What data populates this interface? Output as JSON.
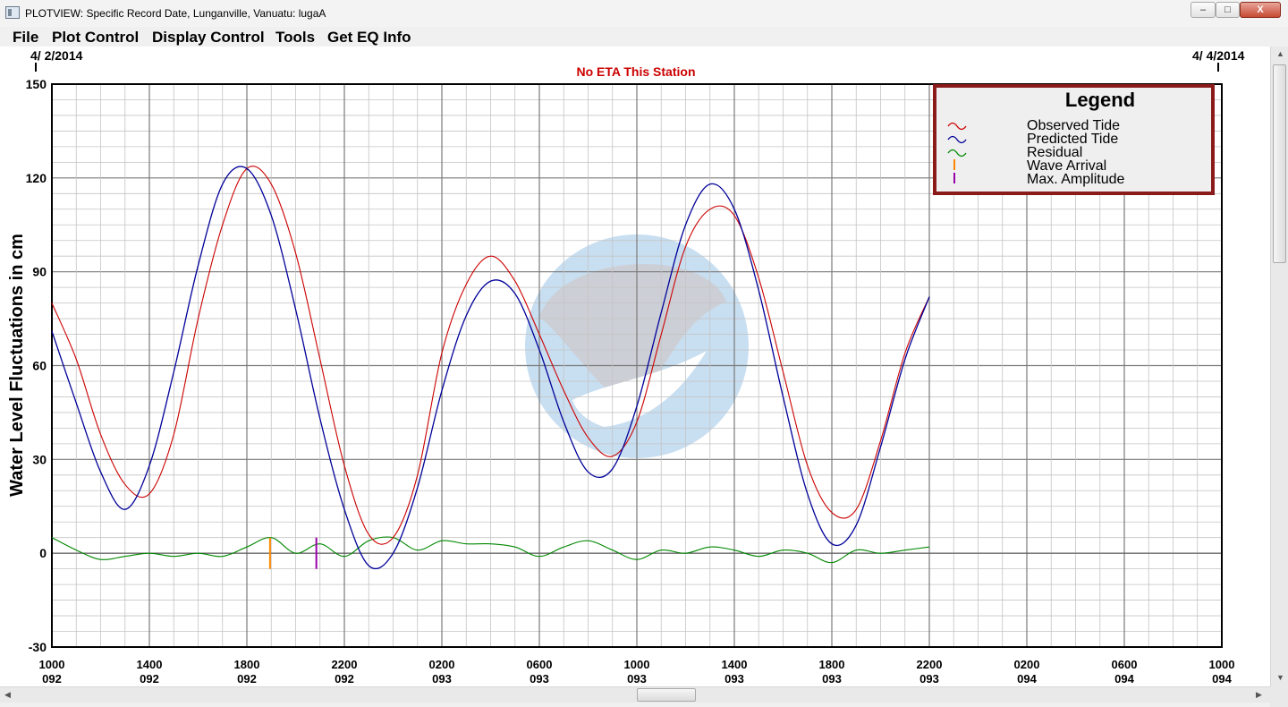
{
  "window": {
    "title": "PLOTVIEW: Specific Record Date, Lunganville, Vanuatu: lugaA",
    "minimize_glyph": "–",
    "maximize_glyph": "□",
    "close_glyph": "X"
  },
  "menu": [
    "File",
    "Plot Control",
    "Display Control",
    "Tools",
    "Get EQ Info"
  ],
  "chart_data": {
    "type": "line",
    "status_text": "No ETA This Station",
    "start_date": "4/ 2/2014",
    "end_date": "4/ 4/2014",
    "ylabel": "Water Level Fluctuations in cm",
    "ylim": [
      -30,
      150
    ],
    "yticks": [
      "150",
      "120",
      "90",
      "60",
      "30",
      "0",
      "-30"
    ],
    "xlim": [
      0,
      48
    ],
    "xticks": [
      {
        "time": "1000",
        "day": "092"
      },
      {
        "time": "1400",
        "day": "092"
      },
      {
        "time": "1800",
        "day": "092"
      },
      {
        "time": "2200",
        "day": "092"
      },
      {
        "time": "0200",
        "day": "093"
      },
      {
        "time": "0600",
        "day": "093"
      },
      {
        "time": "1000",
        "day": "093"
      },
      {
        "time": "1400",
        "day": "093"
      },
      {
        "time": "1800",
        "day": "093"
      },
      {
        "time": "2200",
        "day": "093"
      },
      {
        "time": "0200",
        "day": "094"
      },
      {
        "time": "0600",
        "day": "094"
      },
      {
        "time": "1000",
        "day": "094"
      }
    ],
    "grid": true,
    "legend": {
      "title": "Legend",
      "placement": "top-right",
      "entries": [
        {
          "label": "Observed Tide",
          "color": "#cc0000"
        },
        {
          "label": "Predicted Tide",
          "color": "#000099"
        },
        {
          "label": "Residual",
          "color": "#008800"
        },
        {
          "label": "Wave Arrival",
          "color": "#ff8800"
        },
        {
          "label": "Max. Amplitude",
          "color": "#9900aa"
        }
      ]
    },
    "series": [
      {
        "name": "Predicted Tide",
        "color": "#000099",
        "points": [
          [
            0,
            71
          ],
          [
            1,
            48
          ],
          [
            2,
            26
          ],
          [
            3,
            14
          ],
          [
            4,
            28
          ],
          [
            5,
            58
          ],
          [
            6,
            92
          ],
          [
            7,
            118
          ],
          [
            8,
            123
          ],
          [
            9,
            108
          ],
          [
            10,
            78
          ],
          [
            11,
            43
          ],
          [
            12,
            14
          ],
          [
            13,
            -4
          ],
          [
            14,
            0
          ],
          [
            15,
            21
          ],
          [
            16,
            52
          ],
          [
            17,
            76
          ],
          [
            18,
            87
          ],
          [
            19,
            83
          ],
          [
            20,
            65
          ],
          [
            21,
            42
          ],
          [
            22,
            26
          ],
          [
            23,
            27
          ],
          [
            24,
            47
          ],
          [
            25,
            77
          ],
          [
            26,
            105
          ],
          [
            27,
            118
          ],
          [
            28,
            110
          ],
          [
            29,
            84
          ],
          [
            30,
            50
          ],
          [
            31,
            19
          ],
          [
            32,
            3
          ],
          [
            33,
            9
          ],
          [
            34,
            34
          ],
          [
            35,
            62
          ],
          [
            36,
            82
          ]
        ]
      },
      {
        "name": "Observed Tide",
        "color": "#cc0000",
        "points": [
          [
            0,
            80
          ],
          [
            1,
            62
          ],
          [
            2,
            38
          ],
          [
            3,
            22
          ],
          [
            4,
            19
          ],
          [
            5,
            38
          ],
          [
            6,
            75
          ],
          [
            7,
            105
          ],
          [
            8,
            123
          ],
          [
            9,
            118
          ],
          [
            10,
            96
          ],
          [
            11,
            62
          ],
          [
            12,
            28
          ],
          [
            13,
            6
          ],
          [
            14,
            5
          ],
          [
            15,
            25
          ],
          [
            16,
            64
          ],
          [
            17,
            86
          ],
          [
            18,
            95
          ],
          [
            19,
            87
          ],
          [
            20,
            70
          ],
          [
            21,
            52
          ],
          [
            22,
            37
          ],
          [
            23,
            31
          ],
          [
            24,
            42
          ],
          [
            25,
            70
          ],
          [
            26,
            98
          ],
          [
            27,
            110
          ],
          [
            28,
            108
          ],
          [
            29,
            88
          ],
          [
            30,
            58
          ],
          [
            31,
            28
          ],
          [
            32,
            13
          ],
          [
            33,
            14
          ],
          [
            34,
            36
          ],
          [
            35,
            64
          ],
          [
            36,
            82
          ]
        ]
      },
      {
        "name": "Residual",
        "color": "#008800",
        "points": [
          [
            0,
            5
          ],
          [
            1,
            1
          ],
          [
            2,
            -2
          ],
          [
            3,
            -1
          ],
          [
            4,
            0
          ],
          [
            5,
            -1
          ],
          [
            6,
            0
          ],
          [
            7,
            -1
          ],
          [
            8,
            2
          ],
          [
            9,
            5
          ],
          [
            10,
            0
          ],
          [
            11,
            3
          ],
          [
            12,
            -1
          ],
          [
            13,
            4
          ],
          [
            14,
            5
          ],
          [
            15,
            1
          ],
          [
            16,
            4
          ],
          [
            17,
            3
          ],
          [
            18,
            3
          ],
          [
            19,
            2
          ],
          [
            20,
            -1
          ],
          [
            21,
            2
          ],
          [
            22,
            4
          ],
          [
            23,
            1
          ],
          [
            24,
            -2
          ],
          [
            25,
            1
          ],
          [
            26,
            0
          ],
          [
            27,
            2
          ],
          [
            28,
            1
          ],
          [
            29,
            -1
          ],
          [
            30,
            1
          ],
          [
            31,
            0
          ],
          [
            32,
            -3
          ],
          [
            33,
            1
          ],
          [
            34,
            0
          ],
          [
            35,
            1
          ],
          [
            36,
            2
          ]
        ]
      }
    ],
    "markers": [
      {
        "name": "Wave Arrival",
        "x": 8.95,
        "y_range": [
          -5,
          5
        ],
        "color": "#ff8800"
      },
      {
        "name": "Max. Amplitude",
        "x": 10.85,
        "y_range": [
          -5,
          5
        ],
        "color": "#9900aa"
      }
    ]
  }
}
